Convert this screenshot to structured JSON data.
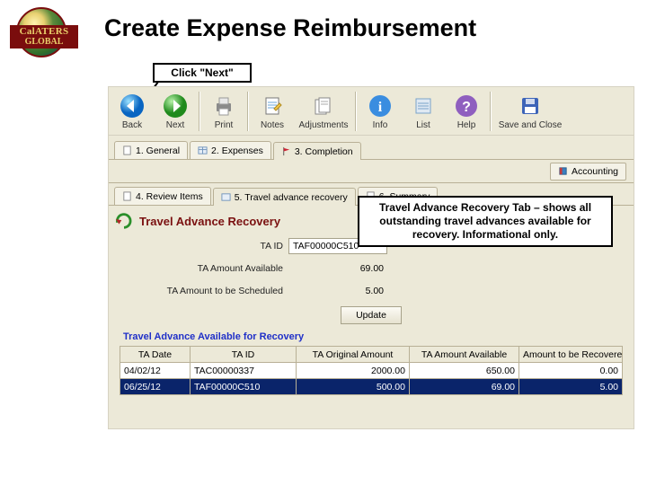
{
  "logo": {
    "l1": "CalATERS",
    "l2": "GLOBAL"
  },
  "page_title": "Create Expense Reimbursement",
  "callouts": {
    "lead": "Click \"Next\"",
    "desc": "Travel Advance Recovery Tab – shows all outstanding travel advances available for recovery. Informational only."
  },
  "toolbar": {
    "back": "Back",
    "next": "Next",
    "print": "Print",
    "notes": "Notes",
    "adjustments": "Adjustments",
    "info": "Info",
    "list": "List",
    "help": "Help",
    "save_close": "Save and Close"
  },
  "main_tabs": {
    "t1": "1. General",
    "t2": "2. Expenses",
    "t3": "3. Completion"
  },
  "accounting_btn": "Accounting",
  "sub_tabs": {
    "s4": "4. Review Items",
    "s5": "5. Travel advance recovery",
    "s6": "6. Summary"
  },
  "panel_title": "Travel Advance Recovery",
  "form": {
    "ta_id_label": "TA ID",
    "ta_id_value": "TAF00000C510",
    "avail_label": "TA Amount Available",
    "avail_value": "69.00",
    "sched_label": "TA Amount to be Scheduled",
    "sched_value": "5.00",
    "update": "Update"
  },
  "section_label": "Travel Advance Available for Recovery",
  "table": {
    "headers": {
      "date": "TA Date",
      "id": "TA ID",
      "orig": "TA Original Amount",
      "avail": "TA Amount Available",
      "rec": "Amount to be Recovered"
    },
    "rows": [
      {
        "date": "04/02/12",
        "id": "TAC00000337",
        "orig": "2000.00",
        "avail": "650.00",
        "rec": "0.00"
      },
      {
        "date": "06/25/12",
        "id": "TAF00000C510",
        "orig": "500.00",
        "avail": "69.00",
        "rec": "5.00"
      }
    ]
  }
}
